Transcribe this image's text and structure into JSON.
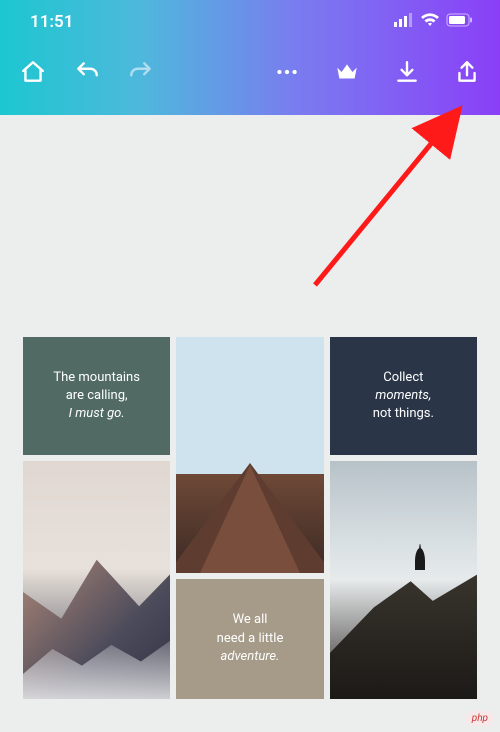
{
  "status": {
    "time": "11:51"
  },
  "tiles": {
    "mountains_line1": "The mountains",
    "mountains_line2": "are calling,",
    "mountains_line3": "I must go.",
    "collect_line1": "Collect",
    "collect_line2": "moments,",
    "collect_line3": "not things.",
    "adventure_line1": "We all",
    "adventure_line2": "need a little",
    "adventure_line3": "adventure."
  },
  "watermark": "php"
}
